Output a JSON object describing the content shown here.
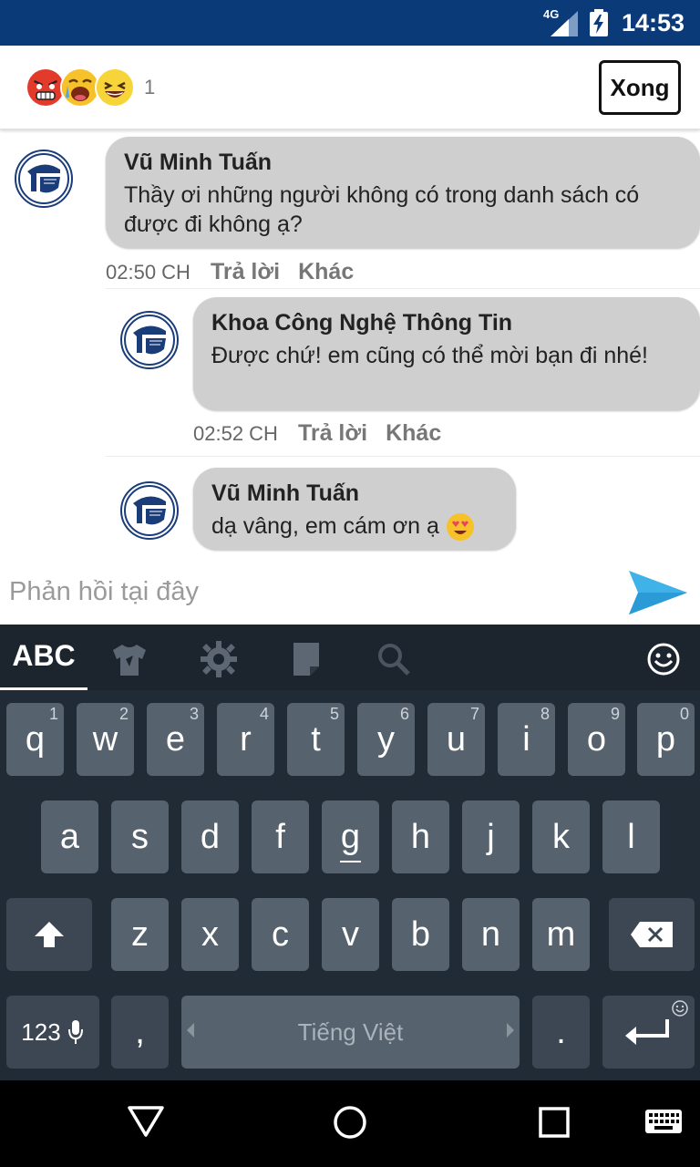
{
  "status_bar": {
    "network": "4G",
    "time": "14:53"
  },
  "header": {
    "reaction_icons": [
      "angry-face-icon",
      "crying-face-icon",
      "laughing-face-icon"
    ],
    "reaction_count": "1",
    "done_label": "Xong"
  },
  "comments": [
    {
      "author": "Vũ Minh Tuấn",
      "text": "Thầy ơi những người không có trong danh sách có được đi không ạ?",
      "time": "02:50 CH",
      "reply_label": "Trả lời",
      "more_label": "Khác"
    },
    {
      "author": "Khoa Công Nghệ Thông Tin",
      "text": "Được chứ! em cũng có thể mời bạn đi nhé!",
      "time": "02:52 CH",
      "reply_label": "Trả lời",
      "more_label": "Khác"
    },
    {
      "author": "Vũ Minh Tuấn",
      "text": "dạ vâng, em cám ơn ạ",
      "emoji": "heart-eyes-emoji-icon"
    }
  ],
  "reply": {
    "placeholder": "Phản hồi tại đây"
  },
  "keyboard": {
    "tab_label": "ABC",
    "row1": [
      {
        "k": "q",
        "h": "1"
      },
      {
        "k": "w",
        "h": "2"
      },
      {
        "k": "e",
        "h": "3"
      },
      {
        "k": "r",
        "h": "4"
      },
      {
        "k": "t",
        "h": "5"
      },
      {
        "k": "y",
        "h": "6"
      },
      {
        "k": "u",
        "h": "7"
      },
      {
        "k": "i",
        "h": "8"
      },
      {
        "k": "o",
        "h": "9"
      },
      {
        "k": "p",
        "h": "0"
      }
    ],
    "row2": [
      "a",
      "s",
      "d",
      "f",
      "g",
      "h",
      "j",
      "k",
      "l"
    ],
    "row3": [
      "z",
      "x",
      "c",
      "v",
      "b",
      "n",
      "m"
    ],
    "numbers_label": "123",
    "comma": ",",
    "period": ".",
    "space_label": "Tiếng Việt"
  }
}
